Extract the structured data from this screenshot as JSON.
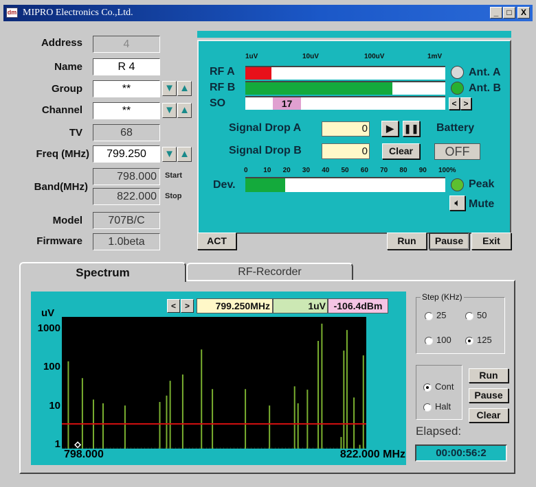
{
  "window": {
    "title": "MIPRO Electronics Co.,Ltd.",
    "icon": "mipro-logo-icon",
    "minimize": "_",
    "maximize": "□",
    "close": "X"
  },
  "receiver": {
    "address": {
      "label": "Address",
      "value": "4"
    },
    "name": {
      "label": "Name",
      "value": "R 4"
    },
    "group": {
      "label": "Group",
      "value": "**"
    },
    "channel": {
      "label": "Channel",
      "value": "**"
    },
    "tv": {
      "label": "TV",
      "value": "68"
    },
    "freq": {
      "label": "Freq (MHz)",
      "value": "799.250"
    },
    "band": {
      "label": "Band(MHz)",
      "start": "798.000",
      "start_label": "Start",
      "stop": "822.000",
      "stop_label": "Stop"
    },
    "model": {
      "label": "Model",
      "value": "707B/C"
    },
    "firmware": {
      "label": "Firmware",
      "value": "1.0beta"
    }
  },
  "monitor": {
    "rf_scale": [
      "1uV",
      "10uV",
      "100uV",
      "1mV"
    ],
    "rf_a": {
      "label": "RF A",
      "level_fraction": 0.13,
      "color": "#e8101a"
    },
    "rf_b": {
      "label": "RF B",
      "level_fraction": 0.735,
      "color": "#14aa3c"
    },
    "so": {
      "label": "SO",
      "value": "17"
    },
    "ant_a": {
      "label": "Ant. A",
      "active": false
    },
    "ant_b": {
      "label": "Ant. B",
      "active": true
    },
    "so_prev": "<",
    "so_next": ">",
    "signal_drop_a": {
      "label": "Signal Drop A",
      "value": "0"
    },
    "signal_drop_b": {
      "label": "Signal Drop B",
      "value": "0"
    },
    "clear": "Clear",
    "battery": {
      "label": "Battery",
      "value": "OFF"
    },
    "dev_scale": [
      "0",
      "10",
      "20",
      "30",
      "40",
      "50",
      "60",
      "70",
      "80",
      "90",
      "100%"
    ],
    "dev": {
      "label": "Dev.",
      "level_percent": 20
    },
    "peak": "Peak",
    "mute": "Mute",
    "act": "ACT",
    "run": "Run",
    "pause": "Pause",
    "exit": "Exit"
  },
  "tabs": [
    {
      "label": "Spectrum",
      "active": true
    },
    {
      "label": "RF-Recorder",
      "active": false
    }
  ],
  "spectrum": {
    "prev": "<",
    "next": ">",
    "marker_freq": "799.250MHz",
    "marker_uv": "1uV",
    "marker_dbm": "-106.4dBm",
    "step": {
      "legend": "Step (KHz)",
      "options": [
        "25",
        "50",
        "100",
        "125"
      ],
      "selected": "125"
    },
    "mode": {
      "options": [
        "Cont",
        "Halt"
      ],
      "selected": "Cont"
    },
    "run": "Run",
    "pause": "Pause",
    "clear": "Clear",
    "elapsed_label": "Elapsed:",
    "elapsed": "00:00:56:2"
  },
  "chart_data": {
    "type": "bar",
    "ylabel": "uV",
    "yscale": "log",
    "yticks": [
      "1000",
      "100",
      "10",
      "1"
    ],
    "xlabel_start": "798.000",
    "xlabel_end": "822.000 MHz",
    "xlim": [
      798.0,
      822.0
    ],
    "ylim": [
      0.8,
      2100
    ],
    "threshold_uV": 3.5,
    "threshold_color": "#d01010",
    "bar_color": "#7ab030",
    "marker": {
      "x": 799.25,
      "y": 1
    },
    "x": [
      798.51,
      799.62,
      800.49,
      801.25,
      802.98,
      805.72,
      806.26,
      806.54,
      807.53,
      809.01,
      809.87,
      812.47,
      814.37,
      816.35,
      816.62,
      817.36,
      818.21,
      818.5,
      820.02,
      820.23,
      820.48,
      821.03,
      821.49,
      821.77
    ],
    "values": [
      148,
      54,
      15,
      12,
      10.5,
      13,
      19,
      46,
      67,
      300,
      28,
      28,
      10.5,
      33,
      12,
      27,
      500,
      1400,
      1.6,
      280,
      960,
      17,
      1.0,
      210
    ]
  }
}
